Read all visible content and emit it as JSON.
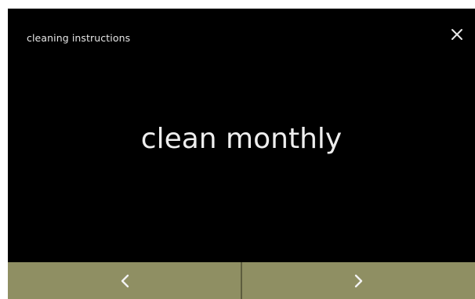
{
  "header": {
    "title": "cleaning instructions",
    "close_icon": "close-icon"
  },
  "main": {
    "message": "clean monthly"
  },
  "navigation": {
    "previous_icon": "chevron-left-icon",
    "next_icon": "chevron-right-icon"
  },
  "colors": {
    "screen_background": "#000000",
    "nav_bar": "#8f8f63",
    "text": "#eeeeee"
  }
}
